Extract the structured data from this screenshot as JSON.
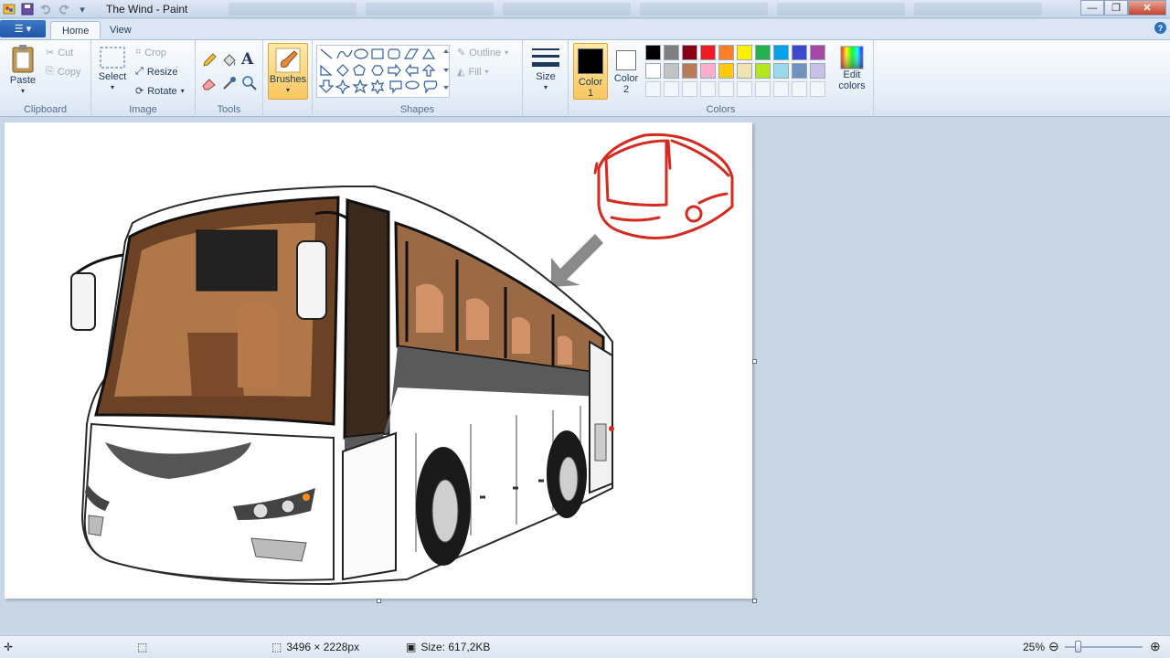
{
  "window": {
    "title": "The Wind - Paint"
  },
  "tabs": {
    "home": "Home",
    "view": "View"
  },
  "clipboard": {
    "paste": "Paste",
    "cut": "Cut",
    "copy": "Copy",
    "group": "Clipboard"
  },
  "image": {
    "select": "Select",
    "crop": "Crop",
    "resize": "Resize",
    "rotate": "Rotate",
    "group": "Image"
  },
  "tools": {
    "group": "Tools"
  },
  "brushes": {
    "label": "Brushes"
  },
  "shapes": {
    "outline": "Outline",
    "fill": "Fill",
    "group": "Shapes"
  },
  "size": {
    "label": "Size"
  },
  "colors": {
    "color1_line1": "Color",
    "color1_line2": "1",
    "color2_line1": "Color",
    "color2_line2": "2",
    "edit_line1": "Edit",
    "edit_line2": "colors",
    "group": "Colors",
    "color1_value": "#000000",
    "color2_value": "#ffffff",
    "palette_row1": [
      "#000000",
      "#7f7f7f",
      "#880015",
      "#ed1c24",
      "#ff7f27",
      "#fff200",
      "#22b14c",
      "#00a2e8",
      "#3f48cc",
      "#a349a4"
    ],
    "palette_row2": [
      "#ffffff",
      "#c3c3c3",
      "#b97a57",
      "#ffaec9",
      "#ffc90e",
      "#efe4b0",
      "#b5e61d",
      "#99d9ea",
      "#7092be",
      "#c8bfe7"
    ]
  },
  "status": {
    "dimensions": "3496 × 2228px",
    "size": "Size: 617,2KB",
    "zoom": "25%"
  }
}
